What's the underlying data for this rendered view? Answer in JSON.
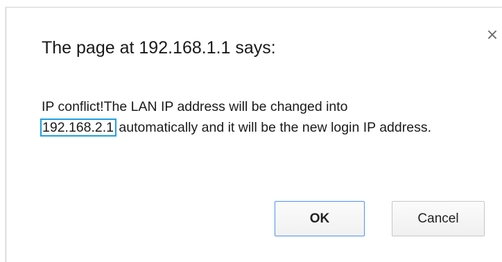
{
  "dialog": {
    "title": "The page at 192.168.1.1 says:",
    "close_glyph": "×",
    "message": {
      "line1": "IP conflict!The LAN IP address will be changed into",
      "new_ip": "192.168.2.1",
      "line2_rest": " automatically and it will be the new login IP address."
    },
    "ok_label": "OK",
    "cancel_label": "Cancel"
  },
  "colors": {
    "highlight_border": "#1ea0e0",
    "ok_border": "#4d90fe"
  }
}
